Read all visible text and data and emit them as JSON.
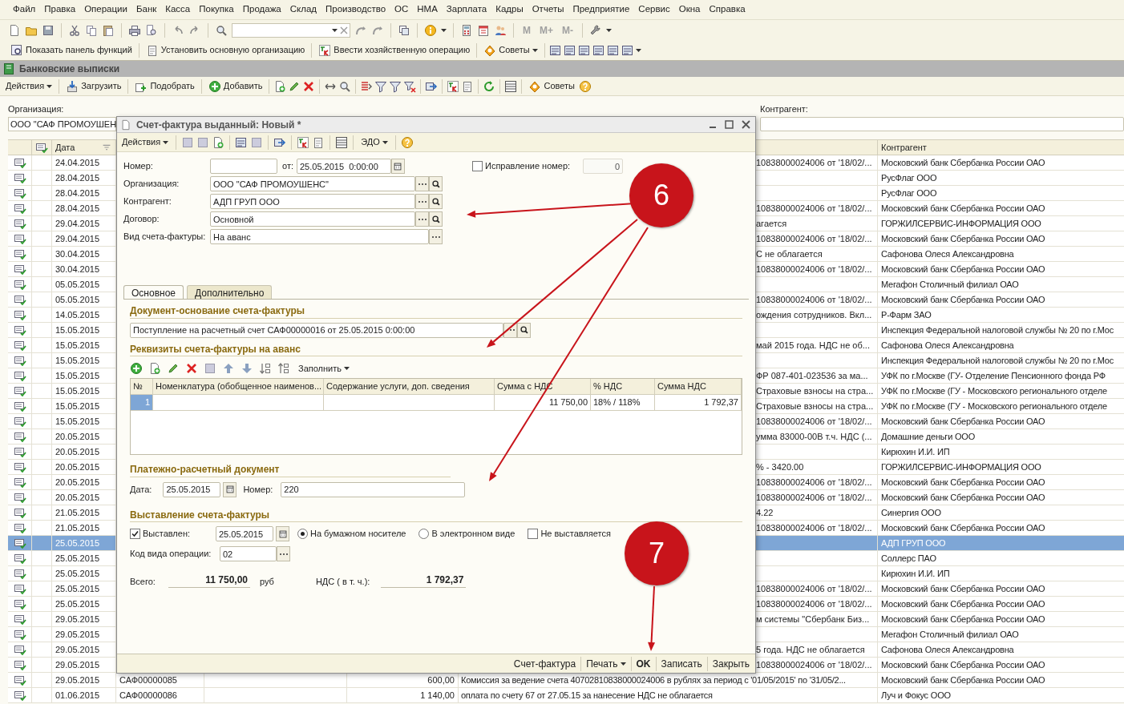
{
  "menu": [
    "Файл",
    "Правка",
    "Операции",
    "Банк",
    "Касса",
    "Покупка",
    "Продажа",
    "Склад",
    "Производство",
    "ОС",
    "НМА",
    "Зарплата",
    "Кадры",
    "Отчеты",
    "Предприятие",
    "Сервис",
    "Окна",
    "Справка"
  ],
  "memory_buttons": [
    "M",
    "M+",
    "M-"
  ],
  "functions_toolbar": [
    {
      "label": "Показать панель функций",
      "dropdown": false
    },
    {
      "label": "Установить основную организацию",
      "dropdown": false
    },
    {
      "label": "Ввести хозяйственную операцию",
      "dropdown": false
    },
    {
      "label": "Советы",
      "dropdown": true
    }
  ],
  "list_window": {
    "title": "Банковские выписки",
    "toolbar": [
      {
        "label": "Действия",
        "dropdown": true
      },
      {
        "label": "Загрузить",
        "dropdown": false
      },
      {
        "label": "Подобрать",
        "dropdown": false
      },
      {
        "label": "Добавить",
        "dropdown": false
      }
    ],
    "tips_button": "Советы",
    "organization": {
      "label": "Организация:",
      "value": "ООО \"САФ ПРОМОУШЕН"
    },
    "counterparty_filter": {
      "label": "Контрагент:"
    },
    "columns": {
      "date": "Дата",
      "counterparty": "Контрагент"
    },
    "rows": [
      {
        "date": "24.04.2015",
        "purpose": "10838000024006 от '18/02/...",
        "counterparty": "Московский банк Сбербанка России ОАО",
        "selected": false
      },
      {
        "date": "28.04.2015",
        "counterparty": "РусФлаг ООО",
        "selected": false
      },
      {
        "date": "28.04.2015",
        "counterparty": "РусФлаг ООО",
        "selected": false
      },
      {
        "date": "28.04.2015",
        "purpose": "10838000024006 от '18/02/...",
        "counterparty": "Московский банк Сбербанка России ОАО",
        "selected": false
      },
      {
        "date": "29.04.2015",
        "purpose": "агается",
        "counterparty": "ГОРЖИЛСЕРВИС-ИНФОРМАЦИЯ ООО",
        "selected": false
      },
      {
        "date": "29.04.2015",
        "purpose": "10838000024006 от '18/02/...",
        "counterparty": "Московский банк Сбербанка России ОАО",
        "selected": false
      },
      {
        "date": "30.04.2015",
        "purpose": "С не облагается",
        "counterparty": "Сафонова Олеся Александровна",
        "selected": false
      },
      {
        "date": "30.04.2015",
        "purpose": "10838000024006 от '18/02/...",
        "counterparty": "Московский банк Сбербанка России ОАО",
        "selected": false
      },
      {
        "date": "05.05.2015",
        "counterparty": "Мегафон Столичный филиал ОАО",
        "selected": false
      },
      {
        "date": "05.05.2015",
        "purpose": "10838000024006 от '18/02/...",
        "counterparty": "Московский банк Сбербанка России ОАО",
        "selected": false
      },
      {
        "date": "14.05.2015",
        "purpose": "ождения сотрудников. Вкл...",
        "counterparty": "Р-Фарм ЗАО",
        "selected": false
      },
      {
        "date": "15.05.2015",
        "counterparty": "Инспекция Федеральной налоговой службы № 20 по г.Мос",
        "selected": false
      },
      {
        "date": "15.05.2015",
        "purpose": "май 2015 года. НДС не об...",
        "counterparty": "Сафонова Олеся Александровна",
        "selected": false
      },
      {
        "date": "15.05.2015",
        "counterparty": "Инспекция Федеральной налоговой службы № 20 по г.Мос",
        "selected": false
      },
      {
        "date": "15.05.2015",
        "purpose": "ФР 087-401-023536 за ма...",
        "counterparty": "УФК по г.Москве (ГУ- Отделение Пенсионного фонда РФ",
        "selected": false
      },
      {
        "date": "15.05.2015",
        "purpose": "Страховые взносы на стра...",
        "counterparty": "УФК по г.Москве (ГУ - Московского регионального отделе",
        "selected": false
      },
      {
        "date": "15.05.2015",
        "purpose": "Страховые взносы на стра...",
        "counterparty": "УФК по г.Москве (ГУ - Московского регионального отделе",
        "selected": false
      },
      {
        "date": "15.05.2015",
        "purpose": "10838000024006 от '18/02/...",
        "counterparty": "Московский банк Сбербанка России ОАО",
        "selected": false
      },
      {
        "date": "20.05.2015",
        "purpose": "умма 83000-00В т.ч. НДС (...",
        "counterparty": "Домашние деньги ООО",
        "selected": false
      },
      {
        "date": "20.05.2015",
        "counterparty": "Кирюхин И.И. ИП",
        "selected": false
      },
      {
        "date": "20.05.2015",
        "purpose": "% - 3420.00",
        "counterparty": "ГОРЖИЛСЕРВИС-ИНФОРМАЦИЯ ООО",
        "selected": false
      },
      {
        "date": "20.05.2015",
        "purpose": "10838000024006 от '18/02/...",
        "counterparty": "Московский банк Сбербанка России ОАО",
        "selected": false
      },
      {
        "date": "20.05.2015",
        "purpose": "10838000024006 от '18/02/...",
        "counterparty": "Московский банк Сбербанка России ОАО",
        "selected": false
      },
      {
        "date": "21.05.2015",
        "purpose": "4.22",
        "counterparty": "Синергия ООО",
        "selected": false
      },
      {
        "date": "21.05.2015",
        "purpose": "10838000024006 от '18/02/...",
        "counterparty": "Московский банк Сбербанка России ОАО",
        "selected": false
      },
      {
        "date": "25.05.2015",
        "counterparty": "АДП ГРУП ООО",
        "selected": true
      },
      {
        "date": "25.05.2015",
        "counterparty": "Соллерс ПАО",
        "selected": false
      },
      {
        "date": "25.05.2015",
        "counterparty": "Кирюхин И.И. ИП",
        "selected": false
      },
      {
        "date": "25.05.2015",
        "purpose": "10838000024006 от '18/02/...",
        "counterparty": "Московский банк Сбербанка России ОАО",
        "selected": false
      },
      {
        "date": "25.05.2015",
        "purpose": "10838000024006 от '18/02/...",
        "counterparty": "Московский банк Сбербанка России ОАО",
        "selected": false
      },
      {
        "date": "29.05.2015",
        "purpose": "м системы \"Сбербанк Биз...",
        "counterparty": "Московский банк Сбербанка России ОАО",
        "selected": false
      },
      {
        "date": "29.05.2015",
        "counterparty": "Мегафон Столичный филиал ОАО",
        "selected": false
      },
      {
        "date": "29.05.2015",
        "purpose": "5 года. НДС не облагается",
        "counterparty": "Сафонова Олеся Александровна",
        "selected": false
      },
      {
        "date": "29.05.2015",
        "purpose": "10838000024006 от '18/02/...",
        "counterparty": "Московский банк Сбербанка России ОАО",
        "selected": false
      },
      {
        "date": "29.05.2015",
        "number": "САФ00000085",
        "amount": "600,00",
        "purpose": "Комиссия за ведение счета  40702810838000024006  в рублях за период с '01/05/2015' по '31/05/2...",
        "counterparty": "Московский банк Сбербанка России ОАО",
        "selected": false
      },
      {
        "date": "01.06.2015",
        "number": "САФ00000086",
        "amount": "1 140,00",
        "purpose": "оплата по счету 67 от 27.05.15 за нанесение НДС не облагается",
        "counterparty": "Луч и Фокус ООО",
        "selected": false
      }
    ]
  },
  "dialog": {
    "title": "Счет-фактура выданный: Новый *",
    "toolbar": [
      {
        "label": "Действия",
        "dropdown": true
      },
      {
        "label": "ЭДО",
        "dropdown": true
      }
    ],
    "number": {
      "label": "Номер:"
    },
    "date": {
      "label": "от:",
      "value": "25.05.2015  0:00:00"
    },
    "correction": {
      "label": "Исправление номер:",
      "checked": false,
      "value": "0"
    },
    "fields": [
      {
        "label": "Организация:",
        "value": "ООО \"САФ ПРОМОУШЕНС\"",
        "kind": "select_search"
      },
      {
        "label": "Контрагент:",
        "value": "АДП ГРУП ООО",
        "kind": "select_search"
      },
      {
        "label": "Договор:",
        "value": "Основной",
        "kind": "select_search"
      },
      {
        "label": "Вид счета-фактуры:",
        "value": "На аванс",
        "kind": "select"
      }
    ],
    "tabs": [
      {
        "label": "Основное",
        "selected": true
      },
      {
        "label": "Дополнительно",
        "selected": false
      }
    ],
    "basis": {
      "title": "Документ-основание счета-фактуры",
      "value": "Поступление на расчетный счет САФ00000016 от 25.05.2015 0:00:00"
    },
    "advance": {
      "title": "Реквизиты счета-фактуры на аванс",
      "fill_button": "Заполнить",
      "columns": [
        "№",
        "Номенклатура (обобщенное наименов...",
        "Содержание услуги, доп. сведения",
        "Сумма с НДС",
        "% НДС",
        "Сумма НДС"
      ],
      "rows": [
        {
          "n": "1",
          "sum": "11 750,00",
          "rate": "18% / 118%",
          "vat": "1 792,37",
          "selected": true
        }
      ]
    },
    "payment_doc": {
      "title": "Платежно-расчетный документ",
      "date_label": "Дата:",
      "date": "25.05.2015",
      "number_label": "Номер:",
      "number": "220"
    },
    "issue": {
      "title": "Выставление счета-фактуры",
      "issued": {
        "label": "Выставлен:",
        "checked": true,
        "date": "25.05.2015"
      },
      "media": [
        {
          "label": "На бумажном носителе",
          "selected": true
        },
        {
          "label": "В электронном виде",
          "selected": false
        }
      ],
      "not_issued": {
        "label": "Не выставляется",
        "checked": false
      },
      "op_code_label": "Код вида операции:",
      "op_code": "02"
    },
    "totals": {
      "total_label": "Всего:",
      "total": "11 750,00",
      "currency": "руб",
      "vat_label": "НДС ( в т. ч.):",
      "vat": "1 792,37"
    },
    "footer": [
      {
        "label": "Счет-фактура",
        "kind": "plain"
      },
      {
        "label": "Печать",
        "kind": "dropdown"
      },
      {
        "label": "OK",
        "kind": "default"
      },
      {
        "label": "Записать",
        "kind": "plain"
      },
      {
        "label": "Закрыть",
        "kind": "plain"
      }
    ]
  },
  "annotations": [
    {
      "label": "6"
    },
    {
      "label": "7"
    }
  ]
}
